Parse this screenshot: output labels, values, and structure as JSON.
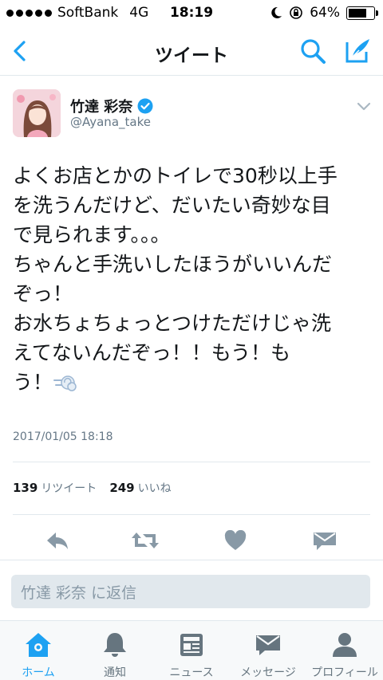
{
  "status_bar": {
    "carrier": "SoftBank",
    "network": "4G",
    "time": "18:19",
    "battery": "64%"
  },
  "nav": {
    "title": "ツイート"
  },
  "tweet": {
    "author_name": "竹達 彩奈",
    "handle": "@Ayana_take",
    "text": "よくお店とかのトイレで30秒以上手\nを洗うんだけど、だいたい奇妙な目\nで見られます。。。\nちゃんと手洗いしたほうがいいんだ\nぞっ！\nお水ちょちょっとつけただけじゃ洗\nえてないんだぞっ！！もう！も\nう！",
    "timestamp": "2017/01/05 18:18",
    "retweet_count": "139",
    "retweet_label": "リツイート",
    "like_count": "249",
    "like_label": "いいね"
  },
  "reply": {
    "placeholder": "竹達 彩奈 に返信"
  },
  "tabs": [
    {
      "label": "ホーム",
      "icon": "home-icon",
      "active": true
    },
    {
      "label": "通知",
      "icon": "bell-icon"
    },
    {
      "label": "ニュース",
      "icon": "news-icon"
    },
    {
      "label": "メッセージ",
      "icon": "message-icon"
    },
    {
      "label": "プロフィール",
      "icon": "profile-icon"
    }
  ],
  "colors": {
    "accent": "#1da1f2",
    "secondary_text": "#657786",
    "divider": "#e1e8ed",
    "action_icon": "#8899a6"
  }
}
